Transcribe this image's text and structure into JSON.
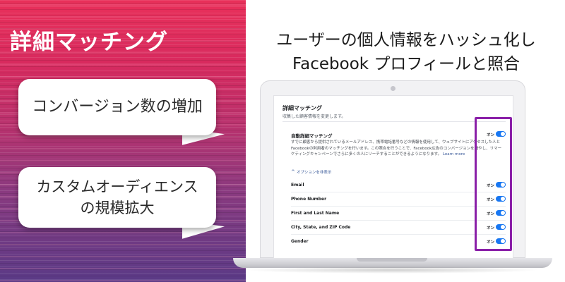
{
  "left_panel": {
    "title": "詳細マッチング",
    "bubble1": "コンバージョン数の増加",
    "bubble2_line1": "カスタムオーディエンス",
    "bubble2_line2": "の規模拡大",
    "colors": {
      "top": "#e8305a",
      "bottom": "#5a3a86"
    }
  },
  "right_panel": {
    "title_line1": "ユーザーの個人情報をハッシュ化し",
    "title_line2": "Facebook プロフィールと照合"
  },
  "screen": {
    "title": "詳細マッチング",
    "subtitle": "収集した顧客情報を変更します。",
    "auto_label": "自動詳細マッチング",
    "auto_toggle": "オン",
    "description": "すでに顧客から提供されているメールアドレス、携帯電話番号などの情報を使用して、ウェブサイトにアクセスした人とFacebookの利用者のマッチングを行います。この照合を行うことで、Facebook広告のコンバージョンを増やし、リマーケティングキャンペーンでさらに多くの人にリーチすることができるようになります。",
    "learn_more": "Learn more",
    "hide_options": "オプションを非表示",
    "rows": [
      {
        "label": "Email",
        "toggle": "オン"
      },
      {
        "label": "Phone Number",
        "toggle": "オン"
      },
      {
        "label": "First and Last Name",
        "toggle": "オン"
      },
      {
        "label": "City, State, and ZIP Code",
        "toggle": "オン"
      },
      {
        "label": "Gender",
        "toggle": "オン"
      }
    ],
    "toggle_color": "#1877f2",
    "highlight_color": "#8a1fa8"
  },
  "icons": {
    "hide_chevron": "chevron-up-icon"
  }
}
